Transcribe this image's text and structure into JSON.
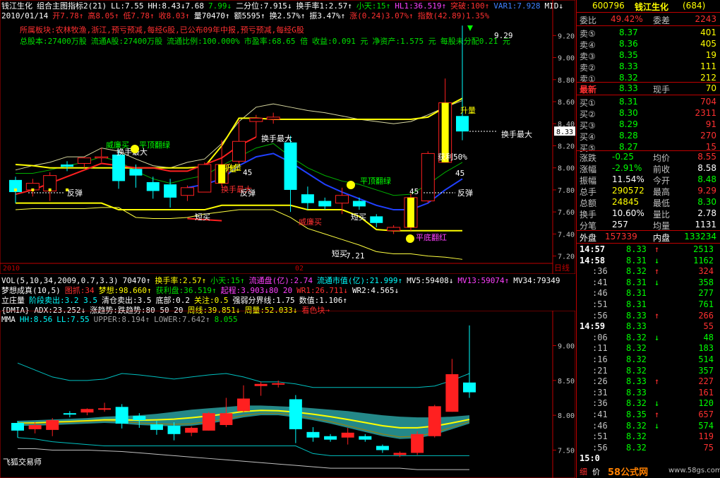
{
  "header": {
    "line1": [
      {
        "t": "钱江生化",
        "c": "wht"
      },
      {
        "t": "组合主图指标2(21)",
        "c": "wht"
      },
      {
        "t": "LL:7.55",
        "c": "wht"
      },
      {
        "t": "HH:8.43↓7.68",
        "c": "wht"
      },
      {
        "t": "7.99↓",
        "c": "grn"
      },
      {
        "t": "二分位:7.915↓",
        "c": "wht"
      },
      {
        "t": "换手率1:2.57↑",
        "c": "wht"
      },
      {
        "t": "小天:15↑",
        "c": "grn"
      },
      {
        "t": "HL1:36.519↑",
        "c": "mag"
      },
      {
        "t": "突破:100↑",
        "c": "red"
      },
      {
        "t": "VAR1:7.928",
        "c": "blu"
      },
      {
        "t": "MID↓",
        "c": "wht"
      }
    ],
    "line2": [
      {
        "t": "2010/01/14",
        "c": "wht"
      },
      {
        "t": "开7.78↑",
        "c": "red"
      },
      {
        "t": "高8.05↑",
        "c": "red"
      },
      {
        "t": "低7.78↑",
        "c": "red"
      },
      {
        "t": "收8.03↑",
        "c": "red"
      },
      {
        "t": "量70470↑",
        "c": "wht"
      },
      {
        "t": "额5595↑",
        "c": "wht"
      },
      {
        "t": "换2.57%↑",
        "c": "wht"
      },
      {
        "t": "振3.47%↑",
        "c": "wht"
      },
      {
        "t": "涨(0.24)3.07%↑",
        "c": "red"
      },
      {
        "t": "指数(42.89)1.35%",
        "c": "red"
      }
    ],
    "line3": "所属板块:农林牧渔,浙江,预亏预减,每经G股,已公布09年中报,预亏预减,每经G股",
    "line4": [
      {
        "t": "总股本:27400万股",
        "c": "grn"
      },
      {
        "t": "流通A股:27400万股",
        "c": "grn"
      },
      {
        "t": "流通比例:100.000%",
        "c": "grn"
      },
      {
        "t": "市盈率:68.65 倍",
        "c": "grn"
      },
      {
        "t": "收益:0.091 元",
        "c": "grn"
      },
      {
        "t": "净资产:1.575 元",
        "c": "grn"
      },
      {
        "t": "每股未分配0.21 元",
        "c": "grn"
      }
    ]
  },
  "main_chart": {
    "yaxis": [
      "9.20",
      "9.00",
      "8.80",
      "8.60",
      "8.40",
      "8.20",
      "8.00",
      "7.80",
      "7.60",
      "7.40",
      "7.20"
    ],
    "current_price_tag": "8.33",
    "xlabels": {
      "left": "2010",
      "mid": "02",
      "right": "日线"
    },
    "annotations": [
      {
        "t": "反弹",
        "c": "wht"
      },
      {
        "t": "威廉买",
        "c": "grn"
      },
      {
        "t": "平顶翻绿",
        "c": "grn"
      },
      {
        "t": "换手最大",
        "c": "wht"
      },
      {
        "t": "换手最大",
        "c": "wht"
      },
      {
        "t": "升量",
        "c": "yel"
      },
      {
        "t": "换手最大",
        "c": "red"
      },
      {
        "t": "反弹",
        "c": "wht"
      },
      {
        "t": "短买",
        "c": "wht"
      },
      {
        "t": "威廉买",
        "c": "red"
      },
      {
        "t": "平顶翻绿",
        "c": "grn"
      },
      {
        "t": "短买",
        "c": "wht"
      },
      {
        "t": "短买",
        "c": "wht"
      },
      {
        "t": "平底翻红",
        "c": "mag"
      },
      {
        "t": "升量",
        "c": "yel"
      },
      {
        "t": "反弹",
        "c": "wht"
      },
      {
        "t": "获利50%",
        "c": "wht"
      },
      {
        "t": "升量",
        "c": "yel"
      },
      {
        "t": "换手最大",
        "c": "wht"
      },
      {
        "t": "9.29",
        "c": "wht"
      },
      {
        "t": "7.21",
        "c": "wht"
      },
      {
        "t": "45",
        "c": "wht"
      },
      {
        "t": "45",
        "c": "wht"
      },
      {
        "t": "45",
        "c": "wht"
      }
    ]
  },
  "indicator_lines": [
    [
      {
        "t": "VOL(5,10,34,2009,0.7,3.3)",
        "c": "wht"
      },
      {
        "t": "70470↑",
        "c": "wht"
      },
      {
        "t": "换手率:2.57↑",
        "c": "yel"
      },
      {
        "t": "小天:15↑",
        "c": "grn"
      },
      {
        "t": "流通盘(亿):2.74",
        "c": "mag"
      },
      {
        "t": "流通市值(亿):21.999↑",
        "c": "cyan"
      },
      {
        "t": "MV5:59408↓",
        "c": "wht"
      },
      {
        "t": "MV13:59074↑",
        "c": "mag"
      },
      {
        "t": "MV34:79349",
        "c": "wht"
      }
    ],
    [
      {
        "t": "梦想成真(10,5)",
        "c": "wht"
      },
      {
        "t": "图抓:34",
        "c": "red"
      },
      {
        "t": "梦想:98.660↑",
        "c": "yel"
      },
      {
        "t": "获利盘:36.519↑",
        "c": "grn"
      },
      {
        "t": "起程:3.903↓80 20",
        "c": "mag"
      },
      {
        "t": "WR1:26.711↓",
        "c": "red"
      },
      {
        "t": "WR2:4.565↓",
        "c": "wht"
      }
    ],
    [
      {
        "t": "立庄量",
        "c": "wht"
      },
      {
        "t": "阶段卖出:3.2 3.5",
        "c": "cyan"
      },
      {
        "t": "清仓卖出:3.5",
        "c": "wht"
      },
      {
        "t": "底部:0.2",
        "c": "wht"
      },
      {
        "t": "关注:0.5",
        "c": "yel"
      },
      {
        "t": "强弱分界线:1.75",
        "c": "wht"
      },
      {
        "t": "数值:1.106↑",
        "c": "wht"
      }
    ],
    [
      {
        "t": "{DMIA} ADX:23.252↓",
        "c": "wht"
      },
      {
        "t": "涨趋势:跌趋势:80 50 20",
        "c": "wht"
      },
      {
        "t": "周线:39.851↓",
        "c": "yel"
      },
      {
        "t": "周量:52.033↓",
        "c": "yel"
      },
      {
        "t": "看色块→",
        "c": "red"
      }
    ],
    [
      {
        "t": "MMA",
        "c": "wht"
      },
      {
        "t": "HH:8.56",
        "c": "cyan"
      },
      {
        "t": "LL:7.55",
        "c": "cyan"
      },
      {
        "t": "UPPER:8.194↑",
        "c": "gry"
      },
      {
        "t": "LOWER:7.642↑",
        "c": "gry"
      },
      {
        "t": "8.055",
        "c": "grn"
      }
    ]
  ],
  "lower_chart": {
    "yaxis": [
      "9.00",
      "8.50",
      "8.00",
      "7.50"
    ],
    "footer_label": "飞狐交易师"
  },
  "chart_data": {
    "type": "candlestick",
    "title": "钱江生化",
    "ylabel": "",
    "ylim": [
      7.14,
      9.33
    ],
    "candles": [
      {
        "o": 7.89,
        "c": 7.78,
        "h": 7.92,
        "l": 7.68
      },
      {
        "o": 7.8,
        "c": 7.86,
        "h": 7.9,
        "l": 7.74
      },
      {
        "o": 7.79,
        "c": 7.93,
        "h": 7.96,
        "l": 7.7
      },
      {
        "o": 8.03,
        "c": 8.01,
        "h": 8.06,
        "l": 7.97
      },
      {
        "o": 8.04,
        "c": 8.09,
        "h": 8.1,
        "l": 8.0
      },
      {
        "o": 8.09,
        "c": 8.1,
        "h": 8.18,
        "l": 8.05
      },
      {
        "o": 8.12,
        "c": 7.88,
        "h": 8.16,
        "l": 7.81
      },
      {
        "o": 7.99,
        "c": 7.93,
        "h": 8.03,
        "l": 7.82
      },
      {
        "o": 7.87,
        "c": 7.79,
        "h": 7.92,
        "l": 7.72
      },
      {
        "o": 7.85,
        "c": 7.73,
        "h": 7.9,
        "l": 7.64
      },
      {
        "o": 7.75,
        "c": 7.82,
        "h": 7.84,
        "l": 7.7
      },
      {
        "o": 7.78,
        "c": 8.03,
        "h": 8.05,
        "l": 7.78
      },
      {
        "o": 7.86,
        "c": 8.03,
        "h": 8.25,
        "l": 7.83
      },
      {
        "o": 8.06,
        "c": 8.24,
        "h": 8.43,
        "l": 8.04
      },
      {
        "o": 8.42,
        "c": 8.45,
        "h": 8.48,
        "l": 8.28
      },
      {
        "o": 8.44,
        "c": 8.46,
        "h": 8.5,
        "l": 8.4
      },
      {
        "o": 8.23,
        "c": 7.8,
        "h": 8.29,
        "l": 7.6
      },
      {
        "o": 7.76,
        "c": 7.68,
        "h": 7.83,
        "l": 7.62
      },
      {
        "o": 7.7,
        "c": 7.65,
        "h": 7.73,
        "l": 7.62
      },
      {
        "o": 7.68,
        "c": 7.75,
        "h": 7.82,
        "l": 7.58
      },
      {
        "o": 7.7,
        "c": 7.65,
        "h": 7.73,
        "l": 7.62
      },
      {
        "o": 7.56,
        "c": 7.5,
        "h": 7.58,
        "l": 7.46
      },
      {
        "o": 7.43,
        "c": 7.46,
        "h": 7.48,
        "l": 7.4
      },
      {
        "o": 7.46,
        "c": 7.73,
        "h": 7.77,
        "l": 7.43
      },
      {
        "o": 7.7,
        "c": 8.13,
        "h": 8.15,
        "l": 7.68
      },
      {
        "o": 8.05,
        "c": 8.59,
        "h": 8.81,
        "l": 8.05
      },
      {
        "o": 8.47,
        "c": 8.33,
        "h": 9.29,
        "l": 8.25
      }
    ],
    "bands": {
      "upper_yellow": [
        8.03,
        8.02,
        8.0,
        8.0,
        8.0,
        8.0,
        8.0,
        8.0,
        8.0,
        8.0,
        8.0,
        8.01,
        8.2,
        8.45,
        8.45,
        8.44,
        8.44,
        8.44,
        8.44,
        8.44,
        8.44,
        8.44,
        8.44,
        8.44,
        8.46,
        8.55,
        8.63
      ],
      "lower_yellow": [
        7.68,
        7.68,
        7.68,
        7.68,
        7.68,
        7.68,
        7.62,
        7.62,
        7.62,
        7.62,
        7.62,
        7.62,
        7.66,
        7.66,
        7.66,
        7.66,
        7.66,
        7.62,
        7.62,
        7.62,
        7.56,
        7.44,
        7.43,
        7.43,
        7.43,
        7.43,
        7.43
      ],
      "blue_ma": [
        null,
        null,
        null,
        null,
        null,
        null,
        null,
        null,
        null,
        null,
        7.82,
        7.85,
        7.9,
        8.02,
        8.1,
        8.13,
        8.05,
        7.95,
        7.85,
        7.78,
        7.72,
        7.66,
        7.62,
        7.62,
        7.68,
        7.8,
        7.9
      ]
    }
  },
  "quote_panel": {
    "code": "600796",
    "name": "钱江生化",
    "rank": "(684)",
    "webi": {
      "label": "委比",
      "val": "49.42%",
      "label2": "委差",
      "val2": "2243"
    },
    "asks": [
      {
        "label": "卖⑤",
        "price": "8.37",
        "vol": "401"
      },
      {
        "label": "卖④",
        "price": "8.36",
        "vol": "405"
      },
      {
        "label": "卖③",
        "price": "8.35",
        "vol": "19"
      },
      {
        "label": "卖②",
        "price": "8.33",
        "vol": "111"
      },
      {
        "label": "卖①",
        "price": "8.32",
        "vol": "212"
      }
    ],
    "latest": {
      "label": "最新",
      "price": "8.33",
      "label2": "现手",
      "vol": "70"
    },
    "bids": [
      {
        "label": "买①",
        "price": "8.31",
        "vol": "704"
      },
      {
        "label": "买②",
        "price": "8.30",
        "vol": "2311"
      },
      {
        "label": "买③",
        "price": "8.29",
        "vol": "91"
      },
      {
        "label": "买④",
        "price": "8.28",
        "vol": "270"
      },
      {
        "label": "买⑤",
        "price": "8.27",
        "vol": "15"
      }
    ],
    "stats": [
      {
        "l1": "涨跌",
        "v1": "-0.25",
        "l2": "均价",
        "v2": "8.55",
        "c1": "grn",
        "c2": "red"
      },
      {
        "l1": "涨幅",
        "v1": "-2.91%",
        "l2": "前收",
        "v2": "8.58",
        "c1": "grn",
        "c2": "wht"
      },
      {
        "l1": "振幅",
        "v1": "11.54%",
        "l2": "今开",
        "v2": "8.48",
        "c1": "wht",
        "c2": "grn"
      },
      {
        "l1": "总手",
        "v1": "290572",
        "l2": "最高",
        "v2": "9.29",
        "c1": "yel",
        "c2": "red"
      },
      {
        "l1": "总额",
        "v1": "24845",
        "l2": "最低",
        "v2": "8.30",
        "c1": "yel",
        "c2": "grn"
      },
      {
        "l1": "换手",
        "v1": "10.60%",
        "l2": "量比",
        "v2": "2.78",
        "c1": "wht",
        "c2": "wht"
      },
      {
        "l1": "分笔",
        "v1": "257",
        "l2": "均量",
        "v2": "1131",
        "c1": "wht",
        "c2": "wht"
      }
    ],
    "waipan": {
      "label": "外盘",
      "val": "157339",
      "label2": "内盘",
      "val2": "133234"
    },
    "ticks": [
      {
        "t": "14:57",
        "p": "8.33",
        "a": "↑",
        "v": "2513",
        "big": true
      },
      {
        "t": "14:58",
        "p": "8.31",
        "a": "↓",
        "v": "1162",
        "big": true
      },
      {
        "t": ":36",
        "p": "8.32",
        "a": "↑",
        "v": "324",
        "vc": "red"
      },
      {
        "t": ":41",
        "p": "8.31",
        "a": "↓",
        "v": "358"
      },
      {
        "t": ":46",
        "p": "8.31",
        "a": "",
        "v": "277"
      },
      {
        "t": ":51",
        "p": "8.31",
        "a": "",
        "v": "761"
      },
      {
        "t": ":56",
        "p": "8.33",
        "a": "↑",
        "v": "266",
        "vc": "red"
      },
      {
        "t": "14:59",
        "p": "8.33",
        "a": "",
        "v": "55",
        "big": true,
        "vc": "red"
      },
      {
        "t": ":06",
        "p": "8.32",
        "a": "↓",
        "v": "48"
      },
      {
        "t": ":11",
        "p": "8.32",
        "a": "",
        "v": "183"
      },
      {
        "t": ":16",
        "p": "8.32",
        "a": "",
        "v": "514"
      },
      {
        "t": ":21",
        "p": "8.32",
        "a": "",
        "v": "357"
      },
      {
        "t": ":26",
        "p": "8.33",
        "a": "↑",
        "v": "227",
        "vc": "red"
      },
      {
        "t": ":31",
        "p": "8.33",
        "a": "",
        "v": "161",
        "vc": "red"
      },
      {
        "t": ":36",
        "p": "8.32",
        "a": "↓",
        "v": "120"
      },
      {
        "t": ":41",
        "p": "8.35",
        "a": "↑",
        "v": "657",
        "vc": "red"
      },
      {
        "t": ":46",
        "p": "8.32",
        "a": "↓",
        "v": "574"
      },
      {
        "t": ":51",
        "p": "8.32",
        "a": "",
        "v": "119",
        "vc": "red"
      },
      {
        "t": ":56",
        "p": "8.32",
        "a": "",
        "v": "75",
        "vc": "red"
      },
      {
        "t": "15:0",
        "p": "",
        "a": "",
        "v": "",
        "big": true
      }
    ],
    "footer": {
      "left": "细",
      "mid": "价",
      "brand": "58公式网",
      "url": "www.58gs.com"
    }
  }
}
